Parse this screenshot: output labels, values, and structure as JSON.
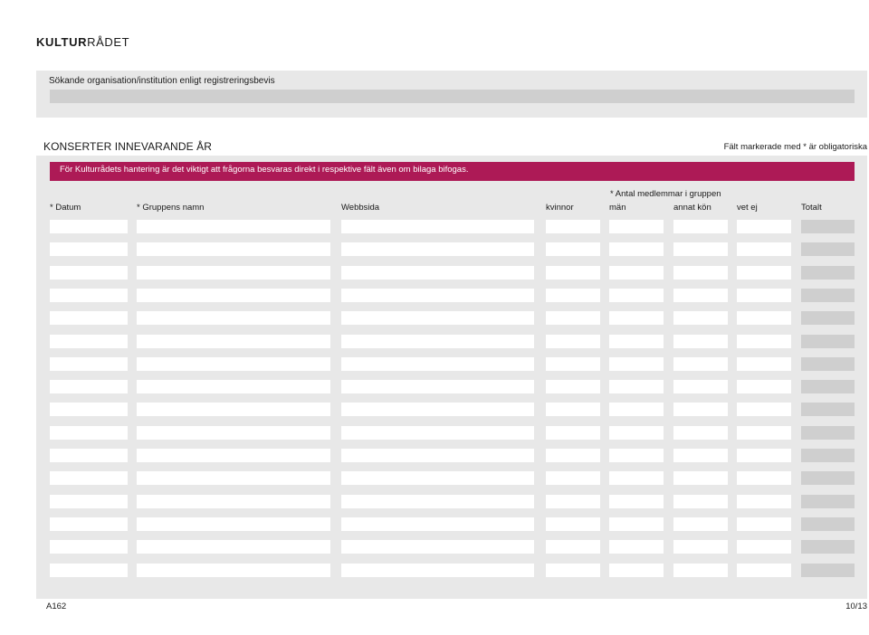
{
  "logo": {
    "bold": "KULTUR",
    "regular": "RÅDET"
  },
  "organisation": {
    "label": "Sökande organisation/institution enligt registreringsbevis",
    "value": ""
  },
  "section": {
    "title": "KONSERTER INNEVARANDE ÅR",
    "required_note": "Fält markerade med * är obligatoriska"
  },
  "banner": "För Kulturrådets hantering är det viktigt att frågorna besvaras direkt i respektive fält även om bilaga bifogas.",
  "group_header": "* Antal medlemmar i gruppen",
  "columns": [
    "* Datum",
    "* Gruppens namn",
    "Webbsida",
    "kvinnor",
    "män",
    "annat kön",
    "vet ej",
    "Totalt"
  ],
  "row_count": 16,
  "rows": [],
  "footer": {
    "code": "A162",
    "page": "10/13"
  },
  "colors": {
    "accent": "#ad1a56",
    "panel": "#e8e8e8",
    "readonly_field": "#cfcfcf"
  }
}
